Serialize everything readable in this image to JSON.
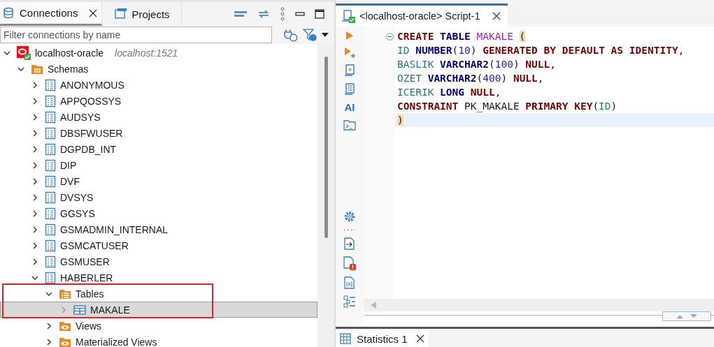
{
  "left_tabs": [
    {
      "kind": "connections",
      "label": "Connections",
      "selected": true,
      "closable": true
    },
    {
      "kind": "projects",
      "label": "Projects",
      "selected": false,
      "closable": false
    }
  ],
  "filter": {
    "placeholder": "Filter connections by name"
  },
  "tree": [
    {
      "kind": "connection",
      "label": "localhost-oracle",
      "detail": "localhost:1521",
      "expanded": true,
      "selected": false,
      "children": [
        {
          "kind": "schemas",
          "label": "Schemas",
          "expanded": true,
          "selected": false,
          "children": [
            {
              "kind": "schema",
              "label": "ANONYMOUS",
              "expanded": false,
              "selected": false
            },
            {
              "kind": "schema",
              "label": "APPQOSSYS",
              "expanded": false,
              "selected": false
            },
            {
              "kind": "schema",
              "label": "AUDSYS",
              "expanded": false,
              "selected": false
            },
            {
              "kind": "schema",
              "label": "DBSFWUSER",
              "expanded": false,
              "selected": false
            },
            {
              "kind": "schema",
              "label": "DGPDB_INT",
              "expanded": false,
              "selected": false
            },
            {
              "kind": "schema",
              "label": "DIP",
              "expanded": false,
              "selected": false
            },
            {
              "kind": "schema",
              "label": "DVF",
              "expanded": false,
              "selected": false
            },
            {
              "kind": "schema",
              "label": "DVSYS",
              "expanded": false,
              "selected": false
            },
            {
              "kind": "schema",
              "label": "GGSYS",
              "expanded": false,
              "selected": false
            },
            {
              "kind": "schema",
              "label": "GSMADMIN_INTERNAL",
              "expanded": false,
              "selected": false
            },
            {
              "kind": "schema",
              "label": "GSMCATUSER",
              "expanded": false,
              "selected": false
            },
            {
              "kind": "schema",
              "label": "GSMUSER",
              "expanded": false,
              "selected": false
            },
            {
              "kind": "schema",
              "label": "HABERLER",
              "expanded": true,
              "selected": false,
              "children": [
                {
                  "kind": "tables",
                  "label": "Tables",
                  "expanded": true,
                  "selected": false,
                  "highlighted": true,
                  "children": [
                    {
                      "kind": "table",
                      "label": "MAKALE",
                      "expanded": false,
                      "selected": true
                    }
                  ]
                },
                {
                  "kind": "views",
                  "label": "Views",
                  "expanded": false,
                  "selected": false
                },
                {
                  "kind": "views",
                  "label": "Materialized Views",
                  "expanded": false,
                  "selected": false
                }
              ]
            }
          ]
        }
      ]
    }
  ],
  "editor_tab": {
    "title": "<localhost-oracle> Script-1",
    "selected": true
  },
  "ruler_tools": [
    {
      "kind": "run"
    },
    {
      "kind": "run-new"
    },
    {
      "kind": "script"
    },
    {
      "kind": "explain"
    },
    {
      "kind": "ai",
      "label": "AI"
    },
    {
      "kind": "terminal"
    },
    {
      "kind": "gap"
    },
    {
      "kind": "gear"
    },
    {
      "kind": "grip"
    },
    {
      "kind": "export"
    },
    {
      "kind": "error"
    },
    {
      "kind": "variables"
    },
    {
      "kind": "outline"
    }
  ],
  "code": [
    {
      "current": false,
      "foldable": true,
      "tokens": [
        {
          "kind": "keyword",
          "text": "CREATE "
        },
        {
          "kind": "type",
          "text": "TABLE "
        },
        {
          "kind": "table",
          "text": "MAKALE "
        },
        {
          "kind": "bracket",
          "text": "("
        }
      ]
    },
    {
      "current": false,
      "foldable": false,
      "tokens": [
        {
          "kind": "column",
          "text": "ID "
        },
        {
          "kind": "type",
          "text": "NUMBER"
        },
        {
          "kind": "plain",
          "text": "("
        },
        {
          "kind": "number",
          "text": "10"
        },
        {
          "kind": "plain",
          "text": ") "
        },
        {
          "kind": "keyword",
          "text": "GENERATED BY DEFAULT AS IDENTITY"
        },
        {
          "kind": "plain",
          "text": ","
        }
      ]
    },
    {
      "current": false,
      "foldable": false,
      "tokens": [
        {
          "kind": "column",
          "text": "BASLIK "
        },
        {
          "kind": "type",
          "text": "VARCHAR2"
        },
        {
          "kind": "plain",
          "text": "("
        },
        {
          "kind": "number",
          "text": "100"
        },
        {
          "kind": "plain",
          "text": ") "
        },
        {
          "kind": "keyword",
          "text": "NULL"
        },
        {
          "kind": "plain",
          "text": ","
        }
      ]
    },
    {
      "current": false,
      "foldable": false,
      "tokens": [
        {
          "kind": "column",
          "text": "OZET "
        },
        {
          "kind": "type",
          "text": "VARCHAR2"
        },
        {
          "kind": "plain",
          "text": "("
        },
        {
          "kind": "number",
          "text": "400"
        },
        {
          "kind": "plain",
          "text": ") "
        },
        {
          "kind": "keyword",
          "text": "NULL"
        },
        {
          "kind": "plain",
          "text": ","
        }
      ]
    },
    {
      "current": false,
      "foldable": false,
      "tokens": [
        {
          "kind": "column",
          "text": "ICERIK "
        },
        {
          "kind": "type",
          "text": "LONG "
        },
        {
          "kind": "keyword",
          "text": "NULL"
        },
        {
          "kind": "plain",
          "text": ","
        }
      ]
    },
    {
      "current": false,
      "foldable": false,
      "tokens": [
        {
          "kind": "keyword",
          "text": "CONSTRAINT"
        },
        {
          "kind": "plain",
          "text": " PK_MAKALE "
        },
        {
          "kind": "keyword",
          "text": "PRIMARY KEY"
        },
        {
          "kind": "plain",
          "text": "("
        },
        {
          "kind": "column",
          "text": "ID"
        },
        {
          "kind": "plain",
          "text": ")"
        }
      ]
    },
    {
      "current": true,
      "foldable": false,
      "tokens": [
        {
          "kind": "bracket",
          "text": ")"
        }
      ]
    }
  ],
  "bottom_tab": {
    "label": "Statistics 1",
    "selected": true
  }
}
